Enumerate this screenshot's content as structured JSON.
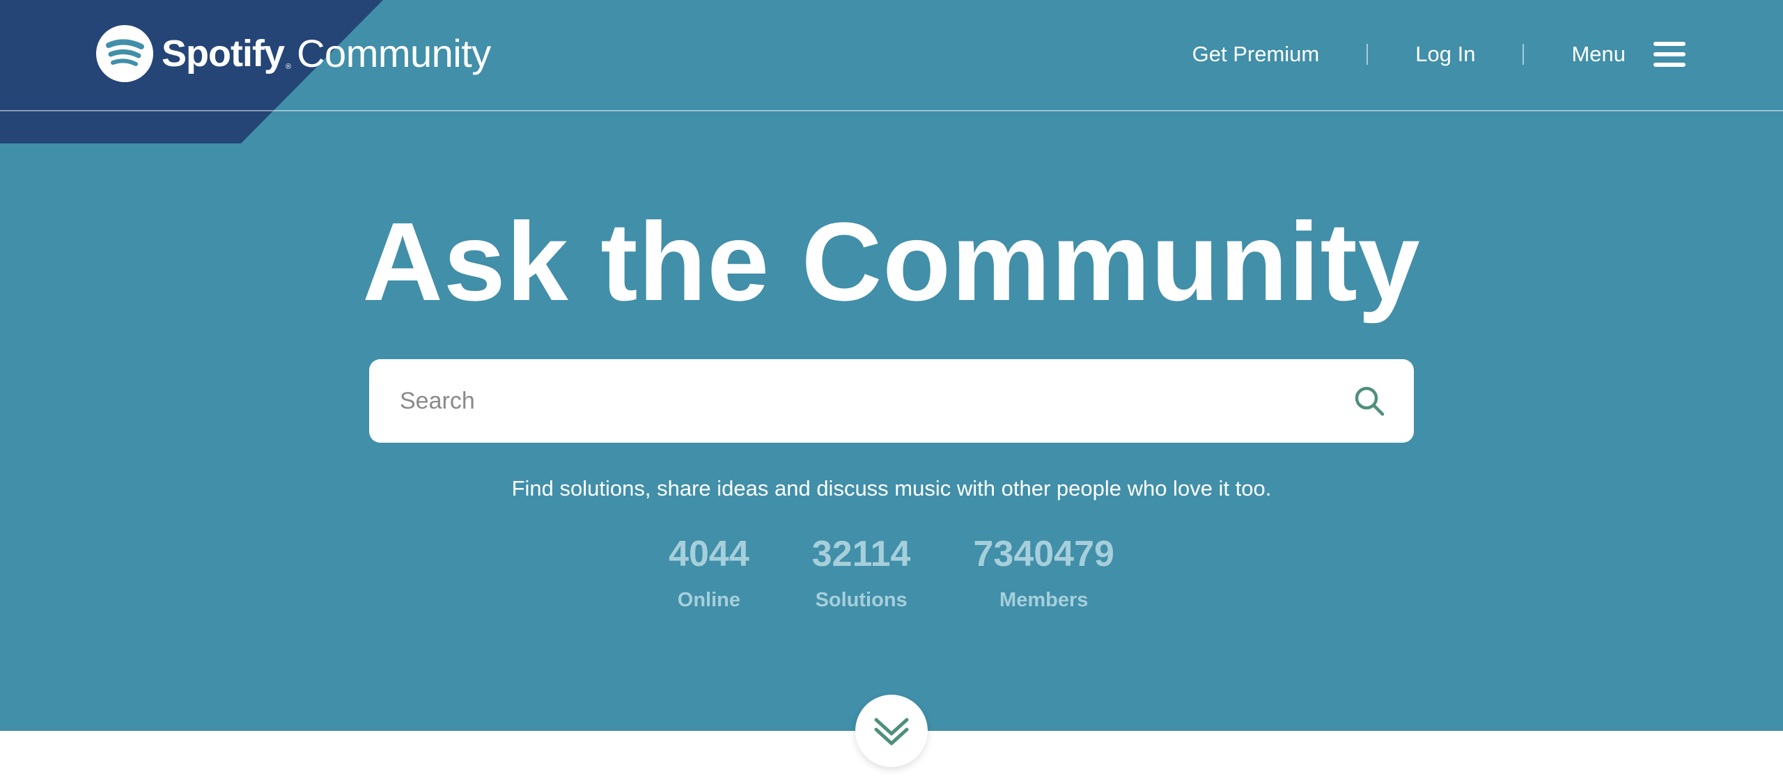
{
  "header": {
    "logo_word": "Spotify",
    "logo_reg": "®",
    "logo_suffix": "Community",
    "nav": {
      "get_premium": "Get Premium",
      "log_in": "Log In",
      "menu": "Menu"
    }
  },
  "hero": {
    "title": "Ask the Community",
    "search": {
      "placeholder": "Search",
      "value": ""
    },
    "tagline": "Find solutions, share ideas and discuss music with other people who love it too.",
    "stats": [
      {
        "value": "4044",
        "label": "Online"
      },
      {
        "value": "32114",
        "label": "Solutions"
      },
      {
        "value": "7340479",
        "label": "Members"
      }
    ]
  },
  "icons": {
    "logo": "spotify-logo-icon",
    "menu": "hamburger-menu-icon",
    "search": "search-icon",
    "scroll": "double-chevron-down-icon"
  },
  "colors": {
    "hero_background": "#418fa9",
    "corner_accent": "#244576",
    "stat_text": "#a6cfdb",
    "accent_green": "#4f8f7e"
  }
}
